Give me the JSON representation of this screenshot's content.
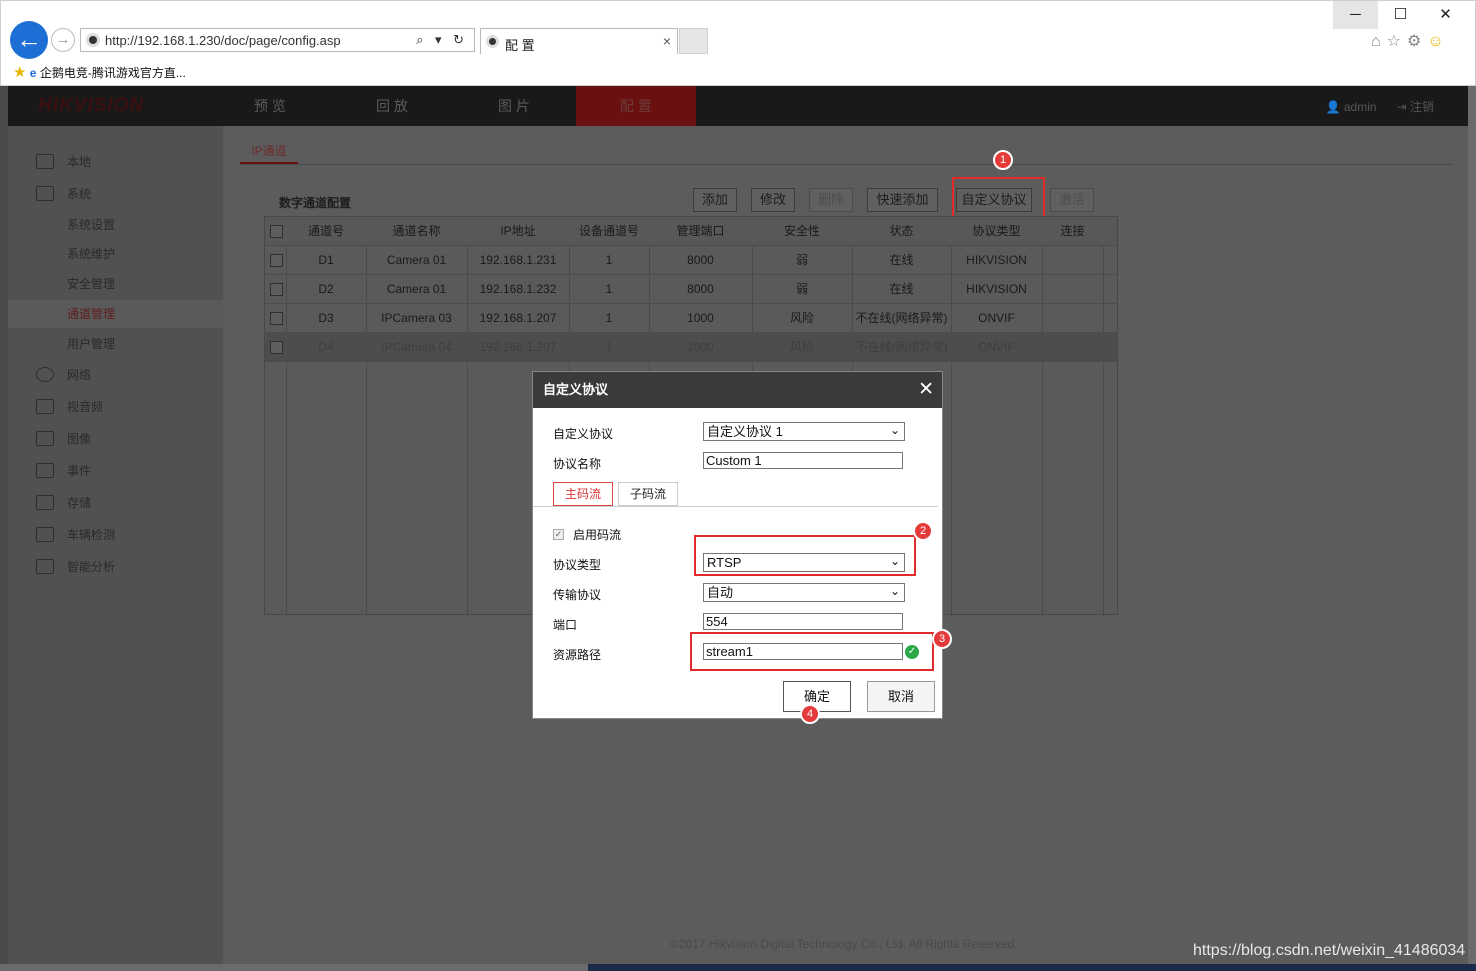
{
  "browser": {
    "url": "http://192.168.1.230/doc/page/config.asp",
    "tab_title": "配 置",
    "favorite": "企鹅电竞-腾讯游戏官方直...",
    "url_tools": "⌕ ▾ ↻",
    "win_min": "─",
    "win_max": "☐",
    "win_close": "✕",
    "tools": [
      "home-icon",
      "star-icon",
      "gear-icon",
      "smiley-icon"
    ]
  },
  "app": {
    "logo": "HIKVISION",
    "nav": [
      "预 览",
      "回 放",
      "图 片",
      "配 置"
    ],
    "active_nav": "配 置",
    "user": "admin",
    "logout": "注销"
  },
  "sidebar": [
    {
      "label": "本地",
      "icon": "monitor-icon",
      "level": 1
    },
    {
      "label": "系统",
      "icon": "system-icon",
      "level": 1
    },
    {
      "label": "系统设置",
      "level": 2
    },
    {
      "label": "系统维护",
      "level": 2
    },
    {
      "label": "安全管理",
      "level": 2
    },
    {
      "label": "通道管理",
      "level": 2,
      "selected": true
    },
    {
      "label": "用户管理",
      "level": 2
    },
    {
      "label": "网络",
      "icon": "globe-icon",
      "level": 1
    },
    {
      "label": "视音频",
      "icon": "audio-video-icon",
      "level": 1
    },
    {
      "label": "图像",
      "icon": "image-icon",
      "level": 1
    },
    {
      "label": "事件",
      "icon": "calendar-icon",
      "level": 1
    },
    {
      "label": "存储",
      "icon": "storage-icon",
      "level": 1
    },
    {
      "label": "车辆检测",
      "icon": "vehicle-detect-icon",
      "level": 1
    },
    {
      "label": "智能分析",
      "icon": "smart-analysis-icon",
      "level": 1
    }
  ],
  "content": {
    "tab": "IP通道",
    "section_title": "数字通道配置",
    "buttons": {
      "add": "添加",
      "modify": "修改",
      "delete": "删除",
      "quick_add": "快速添加",
      "custom_protocol": "自定义协议",
      "activate": "激活"
    },
    "columns": [
      "通道号",
      "通道名称",
      "IP地址",
      "设备通道号",
      "管理端口",
      "安全性",
      "状态",
      "协议类型",
      "连接"
    ],
    "rows": [
      [
        "D1",
        "Camera 01",
        "192.168.1.231",
        "1",
        "8000",
        "弱",
        "在线",
        "HIKVISION",
        ""
      ],
      [
        "D2",
        "Camera 01",
        "192.168.1.232",
        "1",
        "8000",
        "弱",
        "在线",
        "HIKVISION",
        ""
      ],
      [
        "D3",
        "IPCamera 03",
        "192.168.1.207",
        "1",
        "1000",
        "风险",
        "不在线(网络异常)",
        "ONVIF",
        ""
      ],
      [
        "D4",
        "IPCamera 04",
        "192.168.1.207",
        "1",
        "1000",
        "风险",
        "不在线(网络异常)",
        "ONVIF",
        ""
      ]
    ],
    "footer": "©2017 Hikvision Digital Technology Co., Ltd. All Rights Reserved."
  },
  "dialog": {
    "title": "自定义协议",
    "close": "✕",
    "custom_protocol_label": "自定义协议",
    "custom_protocol_value": "自定义协议 1",
    "protocol_name_label": "协议名称",
    "protocol_name_value": "Custom 1",
    "tab_main": "主码流",
    "tab_sub": "子码流",
    "enable_stream_label": "启用码流",
    "protocol_type_label": "协议类型",
    "protocol_type_value": "RTSP",
    "transport_label": "传输协议",
    "transport_value": "自动",
    "port_label": "端口",
    "port_value": "554",
    "resource_path_label": "资源路径",
    "resource_path_value": "stream1",
    "ok": "确定",
    "cancel": "取消"
  },
  "annotations": [
    "1",
    "2",
    "3",
    "4"
  ],
  "watermark": "https://blog.csdn.net/weixin_41486034"
}
